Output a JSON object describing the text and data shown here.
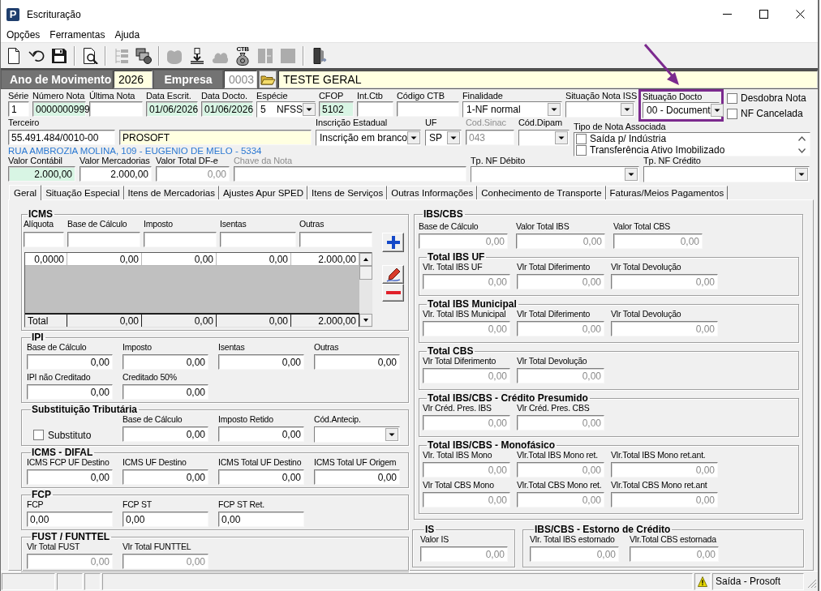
{
  "window": {
    "logo": "P",
    "title": "Escrituração"
  },
  "menu": [
    {
      "label": "Opções"
    },
    {
      "label": "Ferramentas"
    },
    {
      "label": "Ajuda"
    }
  ],
  "toolbar": [
    [
      {
        "kind": "new",
        "disabled": false
      },
      {
        "kind": "undo",
        "disabled": false
      },
      {
        "kind": "save",
        "disabled": false
      }
    ],
    [
      {
        "kind": "preview",
        "disabled": false
      }
    ],
    [
      {
        "kind": "tree",
        "disabled": true
      },
      {
        "kind": "stack",
        "disabled": false
      }
    ],
    [
      {
        "kind": "blob",
        "disabled": true
      },
      {
        "kind": "import",
        "disabled": false
      },
      {
        "kind": "cloud",
        "disabled": true
      },
      {
        "kind": "bag",
        "label": "CTB",
        "disabled": false
      },
      {
        "kind": "split",
        "disabled": true
      },
      {
        "kind": "tile",
        "disabled": true
      }
    ],
    [
      {
        "kind": "exit",
        "disabled": false
      }
    ]
  ],
  "header": {
    "year_label": "Ano de Movimento",
    "year": "2026",
    "company_label": "Empresa",
    "company_code": "0003",
    "company_name": "TESTE GERAL"
  },
  "document": {
    "row_1": [
      {
        "kind": "text",
        "label": "Série",
        "value": "1",
        "highlighted": false
      },
      {
        "kind": "text",
        "label": "Número Nota",
        "value": "0000000999",
        "color": "#d8f5e4",
        "highlighted": false
      },
      {
        "kind": "text",
        "label": "Última Nota",
        "highlighted": false
      },
      {
        "kind": "text",
        "label": "Data Escrit.",
        "value": "01/06/2026",
        "color": "#d8f5e4",
        "highlighted": false
      },
      {
        "kind": "text",
        "label": "Data Docto.",
        "value": "01/06/2026",
        "color": "#d8f5e4",
        "highlighted": false
      },
      {
        "kind": "select",
        "label": "Espécie",
        "value": "5    NFSS",
        "highlighted": false
      },
      {
        "kind": "text",
        "label": "CFOP",
        "value": "5102",
        "color": "#d8f5e4",
        "highlighted": false
      },
      {
        "kind": "text",
        "label": "Int.Ctb",
        "highlighted": false
      },
      {
        "kind": "text",
        "label": "Código CTB",
        "highlighted": false
      },
      {
        "kind": "select",
        "label": "Finalidade",
        "value": "1-NF normal",
        "highlighted": false
      },
      {
        "kind": "select",
        "label": "Situação Nota ISS",
        "highlighted": false
      },
      {
        "kind": "select",
        "label": "Situação Docto",
        "value": "00 - Document",
        "highlighted": true
      }
    ],
    "options": [
      {
        "label": "Desdobra Nota",
        "checked": false
      },
      {
        "label": "NF Cancelada",
        "checked": false
      }
    ],
    "party": {
      "label": "Terceiro",
      "document": "55.491.484/0010-00",
      "name": "PROSOFT",
      "address": "RUA AMBROZIA MOLINA, 109 - EUGENIO DE MELO - 5334"
    },
    "row_2": [
      {
        "kind": "select",
        "label": "Inscrição Estadual",
        "value": "Inscrição em branco",
        "disabled": false
      },
      {
        "kind": "select",
        "label": "UF",
        "value": "SP",
        "disabled": false
      },
      {
        "kind": "text",
        "label": "Cod.Sinac",
        "value": "043",
        "disabled": true
      },
      {
        "kind": "select",
        "label": "Cód.Dipam",
        "disabled": false
      }
    ],
    "associated": {
      "label": "Tipo de Nota Associada",
      "items": [
        {
          "label": "Saída p/ Indústria",
          "checked": false
        },
        {
          "label": "Transferência Ativo Imobilizado",
          "checked": false
        }
      ]
    },
    "row_3": [
      {
        "kind": "amount",
        "label": "Valor Contábil",
        "value": "2.000,00",
        "color": "#d8f5e4",
        "disabled": false
      },
      {
        "kind": "amount",
        "label": "Valor Mercadorias",
        "value": "2.000,00",
        "disabled": false
      },
      {
        "kind": "locked",
        "label": "Valor Total DF-e",
        "value": "0,00",
        "disabled": false
      },
      {
        "kind": "text",
        "label": "Chave da Nota",
        "disabled": true
      },
      {
        "kind": "select",
        "label": "Tp. NF Débito",
        "disabled": false
      },
      {
        "kind": "select",
        "label": "Tp. NF Crédito",
        "disabled": false
      }
    ]
  },
  "tabs": [
    {
      "label": "Geral",
      "selected": true
    },
    {
      "label": "Situação Especial",
      "selected": false
    },
    {
      "label": "Itens de Mercadorias",
      "selected": false
    },
    {
      "label": "Ajustes Apur SPED",
      "selected": false
    },
    {
      "label": "Itens de Serviços",
      "selected": false
    },
    {
      "label": "Outras Informações",
      "selected": false
    },
    {
      "label": "Conhecimento de Transporte",
      "selected": false
    },
    {
      "label": "Faturas/Meios Pagamentos",
      "selected": false
    }
  ],
  "icms": {
    "title": "ICMS",
    "columns": [
      "Alíquota",
      "Base de Cálculo",
      "Imposto",
      "Isentas",
      "Outras"
    ],
    "rows": [
      [
        "0,0000",
        "0,00",
        "0,00",
        "0,00",
        "2.000,00"
      ]
    ],
    "total": {
      "label": "Total",
      "values": [
        "0,00",
        "0,00",
        "0,00",
        "2.000,00"
      ]
    }
  },
  "left_groups": [
    {
      "title": "IPI",
      "kind": "amounts",
      "readonly": false,
      "items": [
        {
          "kind": "field",
          "label": "Base de Cálculo",
          "value": "0,00"
        },
        {
          "kind": "field",
          "label": "Imposto",
          "value": "0,00"
        },
        {
          "kind": "field",
          "label": "Isentas",
          "value": "0,00"
        },
        {
          "kind": "field",
          "label": "Outras",
          "value": "0,00"
        },
        {
          "kind": "field",
          "label": "IPI não Creditado",
          "value": "0,00"
        },
        {
          "kind": "field",
          "label": "Creditado 50%",
          "value": "0,00"
        }
      ]
    },
    {
      "title": "Substituição Tributária",
      "kind": "amounts",
      "readonly": false,
      "option": {
        "label": "Substituto",
        "checked": false
      },
      "items": [
        {
          "kind": "field",
          "label": "Base de Cálculo",
          "value": "0,00"
        },
        {
          "kind": "field",
          "label": "Imposto Retido",
          "value": "0,00"
        },
        {
          "kind": "select",
          "label": "Cód.Antecip."
        }
      ]
    },
    {
      "title": "ICMS - DIFAL",
      "kind": "amounts",
      "readonly": false,
      "items": [
        {
          "kind": "field",
          "label": "ICMS FCP UF Destino",
          "value": "0,00"
        },
        {
          "kind": "field",
          "label": "ICMS UF Destino",
          "value": "0,00"
        },
        {
          "kind": "field",
          "label": "ICMS Total UF Destino",
          "value": "0,00"
        },
        {
          "kind": "field",
          "label": "ICMS Total UF Origem",
          "value": "0,00"
        }
      ]
    },
    {
      "title": "FCP",
      "kind": "entry",
      "readonly": false,
      "items": [
        {
          "kind": "field",
          "label": "FCP",
          "value": "0,00"
        },
        {
          "kind": "field",
          "label": "FCP ST",
          "value": "0,00"
        },
        {
          "kind": "field",
          "label": "FCP ST Ret.",
          "value": "0,00"
        }
      ]
    },
    {
      "title": "FUST / FUNTTEL",
      "kind": "amounts",
      "readonly": true,
      "items": [
        {
          "kind": "field",
          "label": "Vlr Total FUST",
          "value": "0,00"
        },
        {
          "kind": "field",
          "label": "Vlr Total FUNTTEL",
          "value": "0,00"
        }
      ]
    }
  ],
  "ibs_cbs": {
    "title": "IBS/CBS",
    "readonly": true,
    "items": [
      {
        "label": "Base de Cálculo",
        "value": "0,00"
      },
      {
        "label": "Valor Total IBS",
        "value": "0,00"
      },
      {
        "label": "Valor Total CBS",
        "value": "0,00"
      }
    ],
    "groups": [
      {
        "title": "Total IBS UF",
        "readonly": true,
        "items": [
          {
            "label": "Vlr. Total IBS UF",
            "value": "0,00"
          },
          {
            "label": "Vlr Total Diferimento",
            "value": "0,00"
          },
          {
            "label": "Vlr Total Devolução",
            "value": "0,00"
          }
        ]
      },
      {
        "title": "Total IBS Municipal",
        "readonly": true,
        "items": [
          {
            "label": "Vlr. Total IBS Municipal",
            "value": "0,00"
          },
          {
            "label": "Vlr Total Diferimento",
            "value": "0,00"
          },
          {
            "label": "Vlr Total Devolução",
            "value": "0,00"
          }
        ]
      },
      {
        "title": "Total CBS",
        "readonly": true,
        "items": [
          {
            "label": "Vlr Total Diferimento",
            "value": "0,00"
          },
          {
            "label": "Vlr Total Devolução",
            "value": "0,00"
          }
        ]
      },
      {
        "title": "Total IBS/CBS - Crédito Presumido",
        "readonly": true,
        "items": [
          {
            "label": "Vlr Créd. Pres. IBS",
            "value": "0,00"
          },
          {
            "label": "Vlr Créd. Pres. CBS",
            "value": "0,00"
          }
        ]
      },
      {
        "title": "Total IBS/CBS - Monofásico",
        "readonly": true,
        "items": [
          {
            "label": "Vlr. Total IBS Mono",
            "value": "0,00"
          },
          {
            "label": "Vlr.Total IBS Mono ret.",
            "value": "0,00"
          },
          {
            "label": "Vlr.Total IBS Mono ret.ant.",
            "value": "0,00"
          },
          {
            "label": "Vlr Total CBS Mono",
            "value": "0,00"
          },
          {
            "label": "Vlr.Total CBS Mono ret.",
            "value": "0,00"
          },
          {
            "label": "Vlr.Total CBS Mono ret.ant",
            "value": "0,00"
          }
        ]
      }
    ]
  },
  "bottom_groups": [
    {
      "title": "IS",
      "readonly": true,
      "items": [
        {
          "label": "Valor IS",
          "value": "0,00"
        }
      ]
    },
    {
      "title": "IBS/CBS - Estorno de Crédito",
      "readonly": true,
      "items": [
        {
          "label": "Vlr. Total IBS estornado",
          "value": "0,00"
        },
        {
          "label": "Vlr.Total CBS estornada",
          "value": "0,00"
        }
      ]
    }
  ],
  "status_bar": {
    "text": "Saída - Prosoft",
    "warning": true
  }
}
